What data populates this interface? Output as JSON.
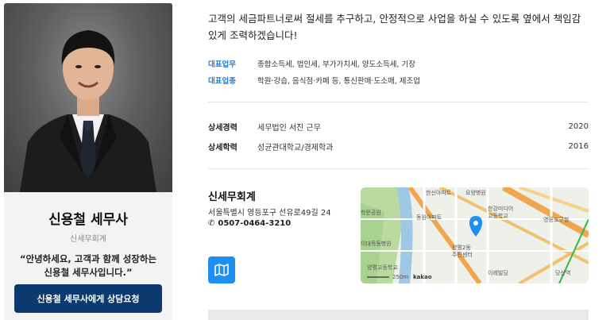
{
  "profile": {
    "name": "신용철 세무사",
    "firm": "신세무회계",
    "quote": "“안녕하세요, 고객과 함께 성장하는 신용철 세무사입니다.”",
    "consult_button": "신용철 세무사에게 상담요청"
  },
  "intro": "고객의 세금파트너로써 절세를 추구하고, 안정적으로 사업을 하실 수 있도록 옆에서 책임감 있게 조력하겠습니다!",
  "business": {
    "main_work_label": "대표업무",
    "main_work_value": "종합소득세, 법인세, 부가가치세, 양도소득세, 기장",
    "main_industry_label": "대표업종",
    "main_industry_value": "학원·강습, 음식점·카페 등, 통신판매·도소매, 제조업"
  },
  "history": [
    {
      "label": "상세경력",
      "value": "세무법인 서진 근무",
      "year": "2020"
    },
    {
      "label": "상세학력",
      "value": "성균관대학교/경제학과",
      "year": "2016"
    }
  ],
  "office": {
    "name": "신세무회계",
    "address": "서울특별시 영등포구 선유로49길 24",
    "phone": "0507-0464-3210"
  },
  "map": {
    "labels": {
      "l1": "한신아파트",
      "l2": "요양병원",
      "l3": "한강미디어",
      "l4": "고등학교",
      "l5": "동원아파트",
      "l6": "학문공원",
      "l7": "이대목동병원",
      "l8": "양평2동",
      "l9": "주민센터",
      "l10": "양평고등학교",
      "l11": "이레빌딩",
      "l12": "당산역",
      "l13": "250m",
      "l14": "kakao",
      "l15": "영등포구청"
    }
  },
  "colors": {
    "accent_blue": "#2a7fd6",
    "button_navy": "#0d3a6e",
    "map_button": "#1f8ef1"
  }
}
